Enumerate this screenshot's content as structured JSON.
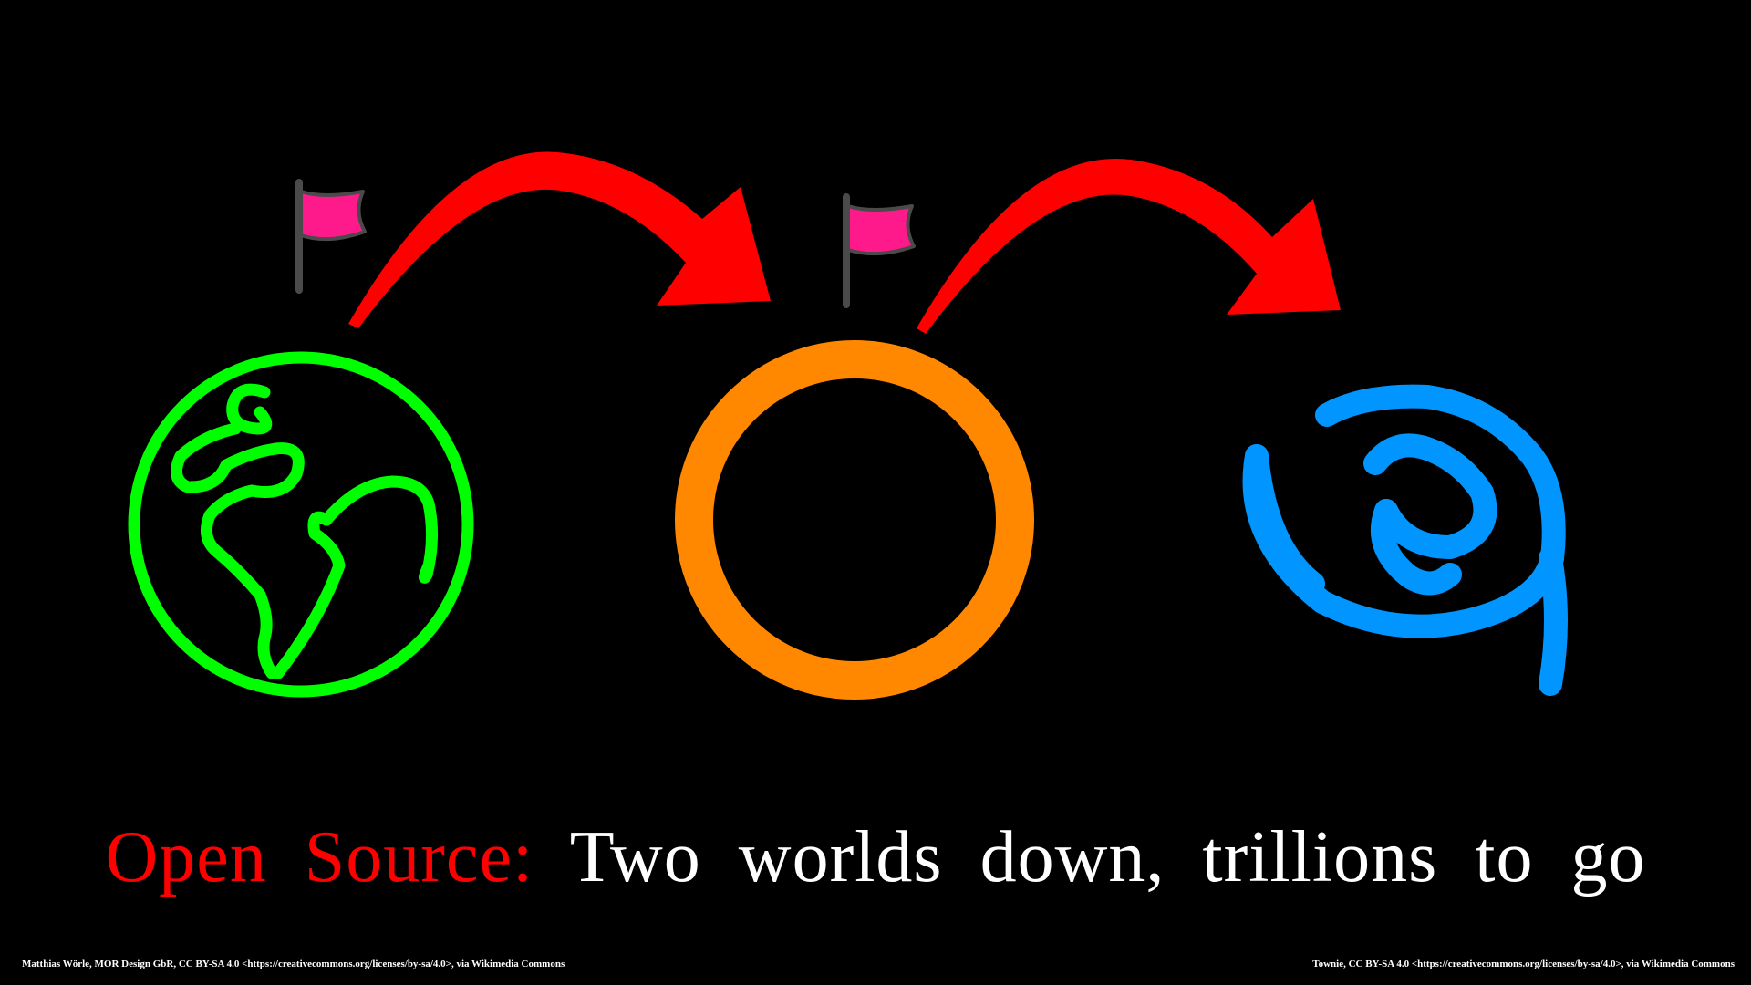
{
  "headline": {
    "prefix": "Open Source:",
    "rest": "Two worlds down, trillions to go"
  },
  "credits": {
    "left": "Matthias Wörle, MOR Design GbR, CC BY-SA 4.0 <https://creativecommons.org/licenses/by-sa/4.0>, via Wikimedia Commons",
    "right": "Townie, CC BY-SA 4.0 <https://creativecommons.org/licenses/by-sa/4.0>, via Wikimedia Commons"
  },
  "icons": [
    {
      "name": "earth-globe-icon",
      "color": "#00ff00"
    },
    {
      "name": "planet-ring-icon",
      "color": "#ff8800"
    },
    {
      "name": "spiral-galaxy-icon",
      "color": "#0095ff"
    },
    {
      "name": "flag-icon",
      "color": "#ff1a8c"
    },
    {
      "name": "curved-arrow-icon",
      "color": "#ff0000"
    }
  ]
}
